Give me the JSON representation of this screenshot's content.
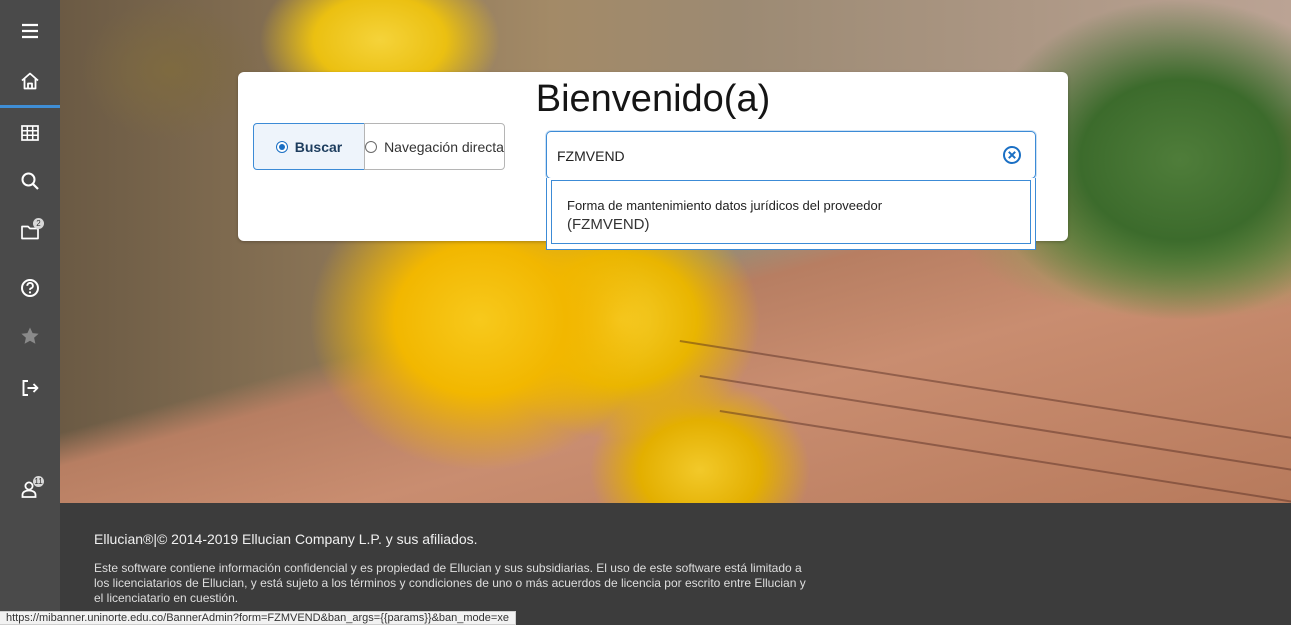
{
  "sidebar": {
    "items": [
      {
        "icon": "menu-icon"
      },
      {
        "icon": "home-icon"
      },
      {
        "icon": "grid-icon"
      },
      {
        "icon": "search-icon"
      },
      {
        "icon": "folder-icon",
        "badge": "2"
      },
      {
        "icon": "help-icon"
      },
      {
        "icon": "star-icon"
      },
      {
        "icon": "sign-out-icon"
      },
      {
        "icon": "user-icon",
        "badge": "11"
      }
    ],
    "accent": "#3f8ed6"
  },
  "welcome": {
    "title": "Bienvenido(a)",
    "mode_search": "Buscar",
    "mode_direct": "Navegación directa",
    "search_value": "FZMVEND",
    "result_title": "Forma de mantenimiento datos jurídicos del proveedor",
    "result_code": "(FZMVEND)"
  },
  "footer": {
    "copyright": "Ellucian®|© 2014-2019 Ellucian Company L.P. y sus afiliados.",
    "legal": "Este software contiene información confidencial y es propiedad de Ellucian y sus subsidiarias. El uso de este software está limitado a los licenciatarios de Ellucian, y está sujeto a los términos y condiciones de uno o más acuerdos de licencia por escrito entre Ellucian y el licenciatario en cuestión."
  },
  "status_url": "https://mibanner.uninorte.edu.co/BannerAdmin?form=FZMVEND&ban_args={{params}}&ban_mode=xe"
}
